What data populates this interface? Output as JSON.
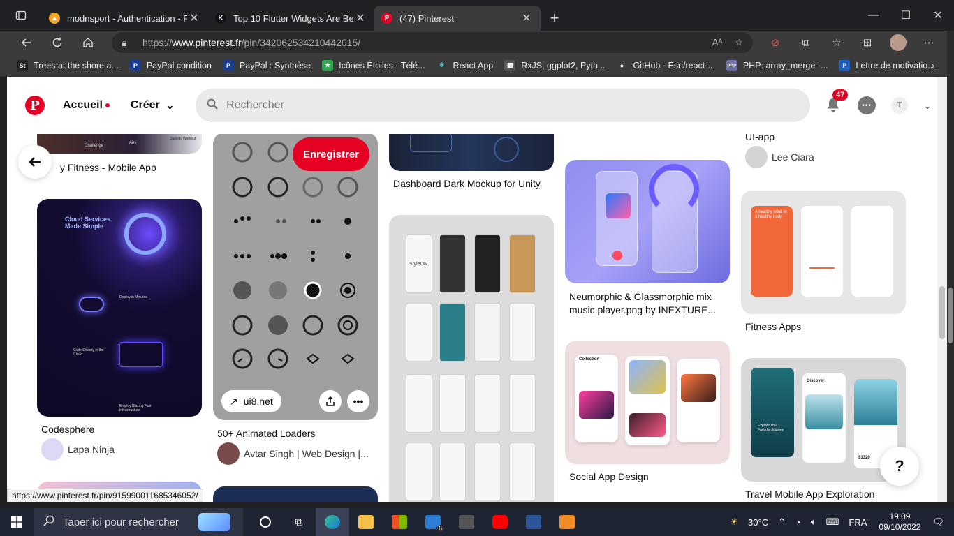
{
  "browser": {
    "tabs": [
      {
        "title": "modnsport - Authentication - Fir",
        "fav_color": "#f5a623",
        "fav_glyph": "▲"
      },
      {
        "title": "Top 10 Flutter Widgets Are Best",
        "fav_color": "#111111",
        "fav_glyph": "K"
      },
      {
        "title": "(47) Pinterest",
        "fav_color": "#e60023",
        "fav_glyph": "P",
        "active": true
      }
    ],
    "url_prefix": "https://",
    "url_host": "www.pinterest.fr",
    "url_path": "/pin/342062534210442015/",
    "bookmarks": [
      {
        "label": "Trees at the shore a...",
        "icon": "St",
        "color": "#222222"
      },
      {
        "label": "PayPal condition",
        "icon": "P",
        "color": "#1a3d8f"
      },
      {
        "label": "PayPal : Synthèse",
        "icon": "P",
        "color": "#1a3d8f"
      },
      {
        "label": "Icônes Étoiles - Télé...",
        "icon": "★",
        "color": "#2ea44f"
      },
      {
        "label": "React App",
        "icon": "⚛",
        "color": "#3b3b3b"
      },
      {
        "label": "RxJS, ggplot2, Pyth...",
        "icon": "▦",
        "color": "#555555"
      },
      {
        "label": "GitHub - Esri/react-...",
        "icon": "●",
        "color": "#3b3b3b"
      },
      {
        "label": "PHP: array_merge -...",
        "icon": "php",
        "color": "#6e6ea8"
      },
      {
        "label": "Lettre de motivatio...",
        "icon": "P",
        "color": "#1f5fbf"
      }
    ]
  },
  "pinterest": {
    "nav": {
      "home": "Accueil",
      "create": "Créer",
      "search_placeholder": "Rechercher",
      "notifications": "47",
      "user_initial": "T"
    },
    "pins": {
      "fitness_mobile": {
        "title": "y Fitness - Mobile App",
        "overlay_1": "Challenge",
        "overlay_2": "Abs",
        "overlay_3": "Statistic Workout"
      },
      "codesphere": {
        "title": "Codesphere",
        "author": "Lapa Ninja",
        "hero": "Cloud Services Made Simple",
        "label_1": "Deploy in Minutes",
        "label_2": "Code Directly in the Cloud",
        "label_3": "Employ Blazing Fast Infrastructure"
      },
      "loaders": {
        "title": "50+ Animated Loaders",
        "author": "Avtar Singh | Web Design |...",
        "save": "Enregistrer",
        "source": "ui8.net"
      },
      "dashboard": {
        "title": "Dashboard Dark Mockup for Unity"
      },
      "styleon": {
        "brand": "StyleON"
      },
      "neumorphic": {
        "title_line1": "Neumorphic & Glassmorphic mix",
        "title_line2": "music player.png by INEXTURE..."
      },
      "social": {
        "title": "Social App Design",
        "header": "Collection"
      },
      "ui_app": {
        "title": "UI-app",
        "author": "Lee Ciara"
      },
      "fitness_apps": {
        "title": "Fitness Apps",
        "hero": "A healthy mind in a healthy body"
      },
      "travel": {
        "title": "Travel Mobile App Exploration",
        "discover": "Discover",
        "explore": "Explore Your Favorite Journey",
        "price": "$1320"
      }
    },
    "help": "?"
  },
  "status_url": "https://www.pinterest.fr/pin/915990011685346052/",
  "taskbar": {
    "search_placeholder": "Taper ici pour rechercher",
    "mail_badge": "6",
    "temperature": "30°C",
    "language": "FRA",
    "time": "19:09",
    "date": "09/10/2022"
  }
}
